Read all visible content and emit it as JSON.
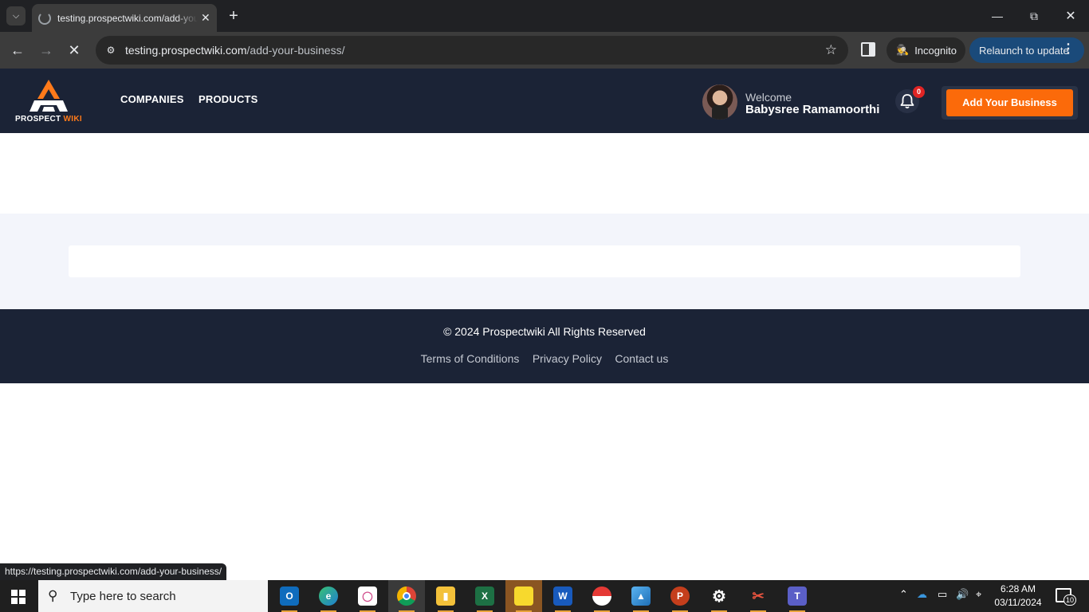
{
  "browser": {
    "tab_title": "testing.prospectwiki.com/add-your-business/",
    "url_host": "testing.prospectwiki.com",
    "url_path": "/add-your-business/",
    "incognito_label": "Incognito",
    "relaunch_label": "Relaunch to update",
    "status_url": "https://testing.prospectwiki.com/add-your-business/"
  },
  "site": {
    "logo_word_1": "PROSPECT ",
    "logo_word_2": "WIKI",
    "nav": [
      "COMPANIES",
      "PRODUCTS"
    ],
    "welcome_label": "Welcome",
    "user_name": "Babysree Ramamoorthi",
    "notification_count": "0",
    "add_business_label": "Add Your Business",
    "accent_color": "#fb6a0a",
    "header_color": "#1b2336"
  },
  "footer": {
    "copyright": "© 2024 Prospectwiki All Rights Reserved",
    "links": [
      "Terms of Conditions",
      "Privacy Policy",
      "Contact us"
    ]
  },
  "taskbar": {
    "search_placeholder": "Type here to search",
    "apps": [
      "outlook-icon",
      "edge-icon",
      "chat-icon",
      "chrome-icon",
      "file-explorer-icon",
      "excel-icon",
      "sticky-notes-icon",
      "word-icon",
      "pokeball-icon",
      "photos-icon",
      "powerpoint-icon",
      "settings-icon",
      "snipping-tool-icon",
      "teams-icon"
    ],
    "time": "6:28 AM",
    "date": "03/11/2024",
    "notification_count": "10"
  }
}
